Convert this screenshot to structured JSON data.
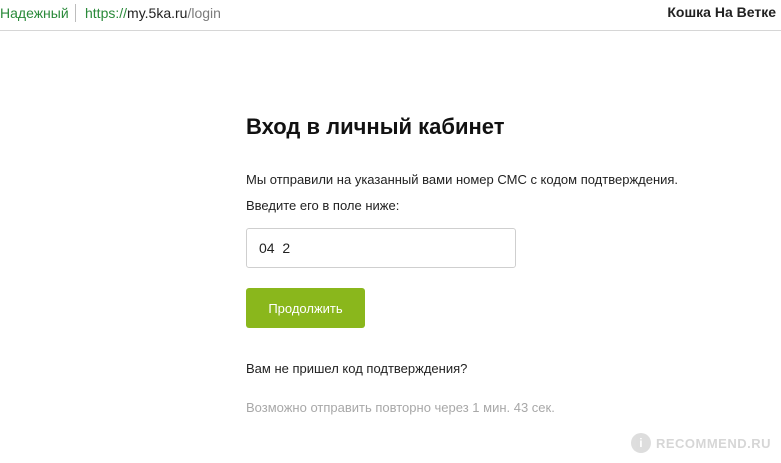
{
  "browser": {
    "secure_label": "Надежный",
    "url_scheme": "https://",
    "url_host": "my.5ka.ru",
    "url_path": "/login",
    "profile_name": "Кошка На Ветке"
  },
  "login": {
    "title": "Вход в личный кабинет",
    "desc_line1": "Мы отправили на указанный вами номер СМС с кодом подтверждения.",
    "desc_line2": "Введите его в поле ниже:",
    "code_value": "04  2",
    "continue_label": "Продолжить",
    "no_code_text": "Вам не пришел код подтверждения?",
    "resend_text": "Возможно отправить повторно через 1 мин. 43 сек."
  },
  "watermark": {
    "badge": "i",
    "text": "RECOMMEND.RU"
  },
  "colors": {
    "accent_green": "#8ab71c",
    "secure_green": "#2a8a3a",
    "muted_text": "#a8a8a8"
  }
}
